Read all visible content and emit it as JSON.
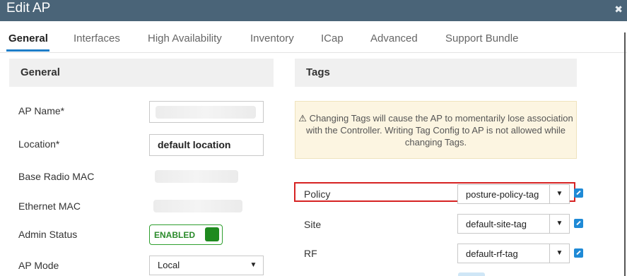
{
  "window": {
    "title": "Edit AP",
    "close_icon": "close-icon"
  },
  "tabs": [
    {
      "label": "General",
      "active": true
    },
    {
      "label": "Interfaces"
    },
    {
      "label": "High Availability"
    },
    {
      "label": "Inventory"
    },
    {
      "label": "ICap"
    },
    {
      "label": "Advanced"
    },
    {
      "label": "Support Bundle"
    }
  ],
  "general": {
    "heading": "General",
    "ap_name": {
      "label": "AP Name*",
      "value": ""
    },
    "location": {
      "label": "Location*",
      "value": "default location"
    },
    "base_radio_mac": {
      "label": "Base Radio MAC",
      "value": ""
    },
    "ethernet_mac": {
      "label": "Ethernet MAC",
      "value": ""
    },
    "admin_status": {
      "label": "Admin Status",
      "value": "ENABLED",
      "color": "#2a8a2a"
    },
    "ap_mode": {
      "label": "AP Mode",
      "value": "Local"
    }
  },
  "tags": {
    "heading": "Tags",
    "warning": "Changing Tags will cause the AP to momentarily lose association with the Controller. Writing Tag Config to AP is not allowed while changing Tags.",
    "warning_icon": "warning-icon",
    "policy": {
      "label": "Policy",
      "value": "posture-policy-tag"
    },
    "site": {
      "label": "Site",
      "value": "default-site-tag"
    },
    "rf": {
      "label": "RF",
      "value": "default-rf-tag"
    }
  },
  "colors": {
    "titlebar": "#4a6478",
    "active_tab": "#1e7ec8",
    "highlight": "#d62222",
    "toggle": "#1e8a1e"
  }
}
